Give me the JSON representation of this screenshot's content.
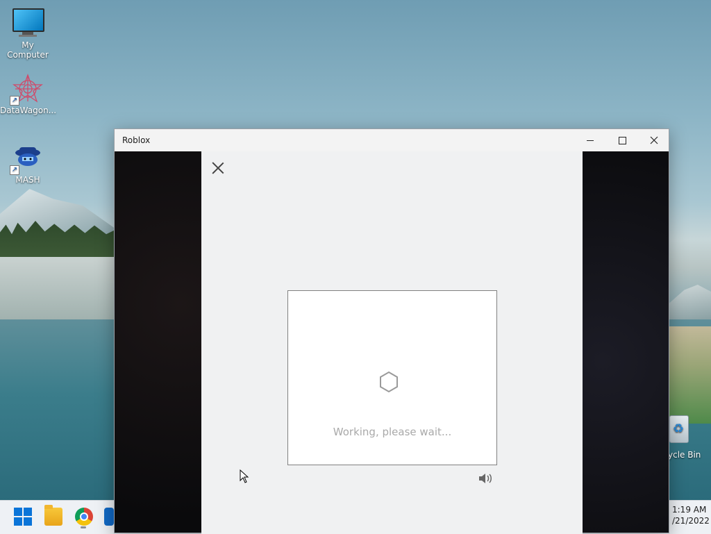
{
  "desktop": {
    "icons": [
      {
        "label": "My Computer",
        "icon": "monitor-icon"
      },
      {
        "label": "DataWagon...",
        "icon": "datawagon-icon"
      },
      {
        "label": "MASH",
        "icon": "mash-icon"
      }
    ],
    "recycle_bin": {
      "label": "ycle Bin",
      "icon": "recycle-bin-icon"
    }
  },
  "taskbar": {
    "apps": [
      "start-icon",
      "file-explorer-icon",
      "chrome-icon",
      "store-icon"
    ],
    "clock": {
      "time": "1:19 AM",
      "date": "/21/2022"
    }
  },
  "window": {
    "title": "Roblox",
    "controls": {
      "minimize": "minimize-icon",
      "maximize": "maximize-icon",
      "close": "close-icon"
    },
    "dialog": {
      "close_icon": "close-icon",
      "status_text": "Working, please wait...",
      "spinner_icon": "hexagon-spinner-icon",
      "audio_icon": "speaker-icon"
    }
  },
  "colors": {
    "taskbar_bg": "#eef1f5",
    "panel_bg": "#f0f1f2",
    "status_text": "#a9a9a9",
    "start_blue": "#0a74d8"
  }
}
